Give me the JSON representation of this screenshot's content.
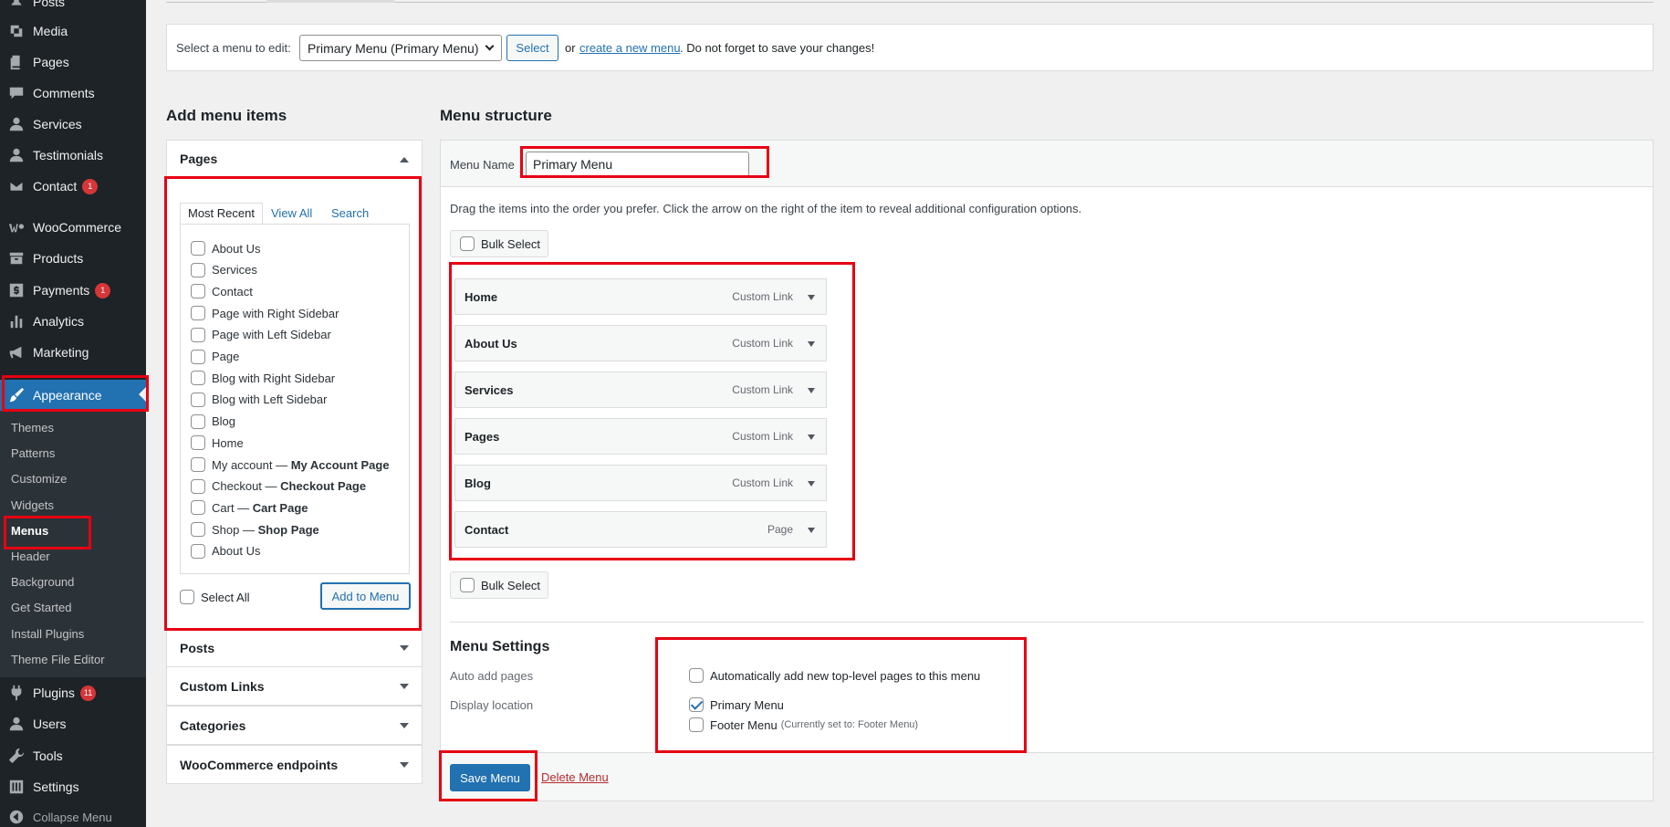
{
  "sidebar": {
    "items": [
      {
        "label": "Posts",
        "icon": "pin-icon"
      },
      {
        "label": "Media",
        "icon": "media-icon"
      },
      {
        "label": "Pages",
        "icon": "pages-icon"
      },
      {
        "label": "Comments",
        "icon": "comment-icon"
      },
      {
        "label": "Services",
        "icon": "person-icon"
      },
      {
        "label": "Testimonials",
        "icon": "person-icon"
      },
      {
        "label": "Contact",
        "icon": "mail-icon",
        "badge": "1"
      },
      {
        "label": "WooCommerce",
        "icon": "woo-icon"
      },
      {
        "label": "Products",
        "icon": "archive-icon"
      },
      {
        "label": "Payments",
        "icon": "dollar-icon",
        "badge": "1"
      },
      {
        "label": "Analytics",
        "icon": "bar-chart-icon"
      },
      {
        "label": "Marketing",
        "icon": "megaphone-icon"
      },
      {
        "label": "Appearance",
        "icon": "brush-icon"
      },
      {
        "label": "Plugins",
        "icon": "plug-icon",
        "badge": "11"
      },
      {
        "label": "Users",
        "icon": "person-icon"
      },
      {
        "label": "Tools",
        "icon": "wrench-icon"
      },
      {
        "label": "Settings",
        "icon": "sliders-icon"
      },
      {
        "label": "Collapse Menu",
        "icon": "collapse-icon"
      }
    ],
    "submenu": [
      "Themes",
      "Patterns",
      "Customize",
      "Widgets",
      "Menus",
      "Header",
      "Background",
      "Get Started",
      "Install Plugins",
      "Theme File Editor"
    ]
  },
  "select_bar": {
    "label": "Select a menu to edit:",
    "selected": "Primary Menu (Primary Menu)",
    "select_button": "Select",
    "or_text": "or",
    "create_link": "create a new menu",
    "reminder": ". Do not forget to save your changes!"
  },
  "add_items": {
    "heading": "Add menu items",
    "pages_title": "Pages",
    "tabs": [
      "Most Recent",
      "View All",
      "Search"
    ],
    "pages": [
      {
        "label": "About Us",
        "suffix": ""
      },
      {
        "label": "Services",
        "suffix": ""
      },
      {
        "label": "Contact",
        "suffix": ""
      },
      {
        "label": "Page with Right Sidebar",
        "suffix": ""
      },
      {
        "label": "Page with Left Sidebar",
        "suffix": ""
      },
      {
        "label": "Page",
        "suffix": ""
      },
      {
        "label": "Blog with Right Sidebar",
        "suffix": ""
      },
      {
        "label": "Blog with Left Sidebar",
        "suffix": ""
      },
      {
        "label": "Blog",
        "suffix": ""
      },
      {
        "label": "Home",
        "suffix": ""
      },
      {
        "label": "My account — ",
        "suffix": "My Account Page"
      },
      {
        "label": "Checkout — ",
        "suffix": "Checkout Page"
      },
      {
        "label": "Cart — ",
        "suffix": "Cart Page"
      },
      {
        "label": "Shop — ",
        "suffix": "Shop Page"
      },
      {
        "label": "About Us",
        "suffix": ""
      }
    ],
    "select_all": "Select All",
    "add_button": "Add to Menu",
    "other_sections": [
      "Posts",
      "Custom Links",
      "Categories",
      "WooCommerce endpoints"
    ]
  },
  "structure": {
    "heading": "Menu structure",
    "name_label": "Menu Name",
    "name_value": "Primary Menu",
    "instructions": "Drag the items into the order you prefer. Click the arrow on the right of the item to reveal additional configuration options.",
    "bulk_select": "Bulk Select",
    "items": [
      {
        "label": "Home",
        "type": "Custom Link"
      },
      {
        "label": "About Us",
        "type": "Custom Link"
      },
      {
        "label": "Services",
        "type": "Custom Link"
      },
      {
        "label": "Pages",
        "type": "Custom Link"
      },
      {
        "label": "Blog",
        "type": "Custom Link"
      },
      {
        "label": "Contact",
        "type": "Page"
      }
    ]
  },
  "settings": {
    "heading": "Menu Settings",
    "auto_label": "Auto add pages",
    "auto_option": "Automatically add new top-level pages to this menu",
    "location_label": "Display location",
    "location_primary": "Primary Menu",
    "location_footer": "Footer Menu",
    "location_footer_note": "(Currently set to: Footer Menu)",
    "primary_checked": true
  },
  "footer": {
    "save": "Save Menu",
    "delete": "Delete Menu"
  },
  "colors": {
    "accent": "#2271b1",
    "highlight": "#e60012",
    "sidebar": "#1d2327"
  }
}
